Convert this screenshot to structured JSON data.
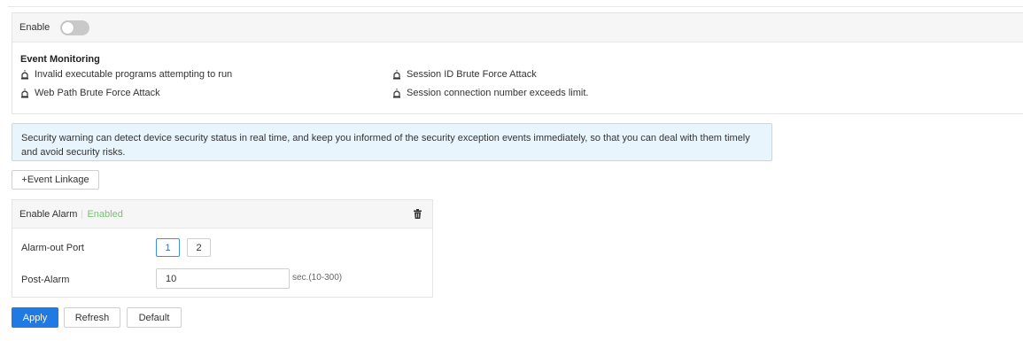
{
  "enable": {
    "label": "Enable",
    "on": false
  },
  "monitoring": {
    "title": "Event Monitoring",
    "events": [
      "Invalid executable programs attempting to run",
      "Session ID Brute Force Attack",
      "Web Path Brute Force Attack",
      "Session connection number exceeds limit."
    ]
  },
  "info": {
    "text": "Security warning can detect device security status in real time, and keep you informed of the security exception events immediately, so that you can deal with them timely and avoid security risks."
  },
  "linkage": {
    "add_label": "+Event Linkage"
  },
  "alarm": {
    "title": "Enable Alarm",
    "status": "Enabled",
    "port_label": "Alarm-out Port",
    "ports": [
      "1",
      "2"
    ],
    "selected_port": "1",
    "post_label": "Post-Alarm",
    "post_value": "10",
    "post_hint": "sec.(10-300)"
  },
  "actions": {
    "apply": "Apply",
    "refresh": "Refresh",
    "default": "Default"
  },
  "colors": {
    "accent": "#1f7ae4",
    "info_bg": "#e9f5fd",
    "info_border": "#b5dcf6",
    "enabled": "#72c46d",
    "toggle_off": "#c9c9c9"
  }
}
